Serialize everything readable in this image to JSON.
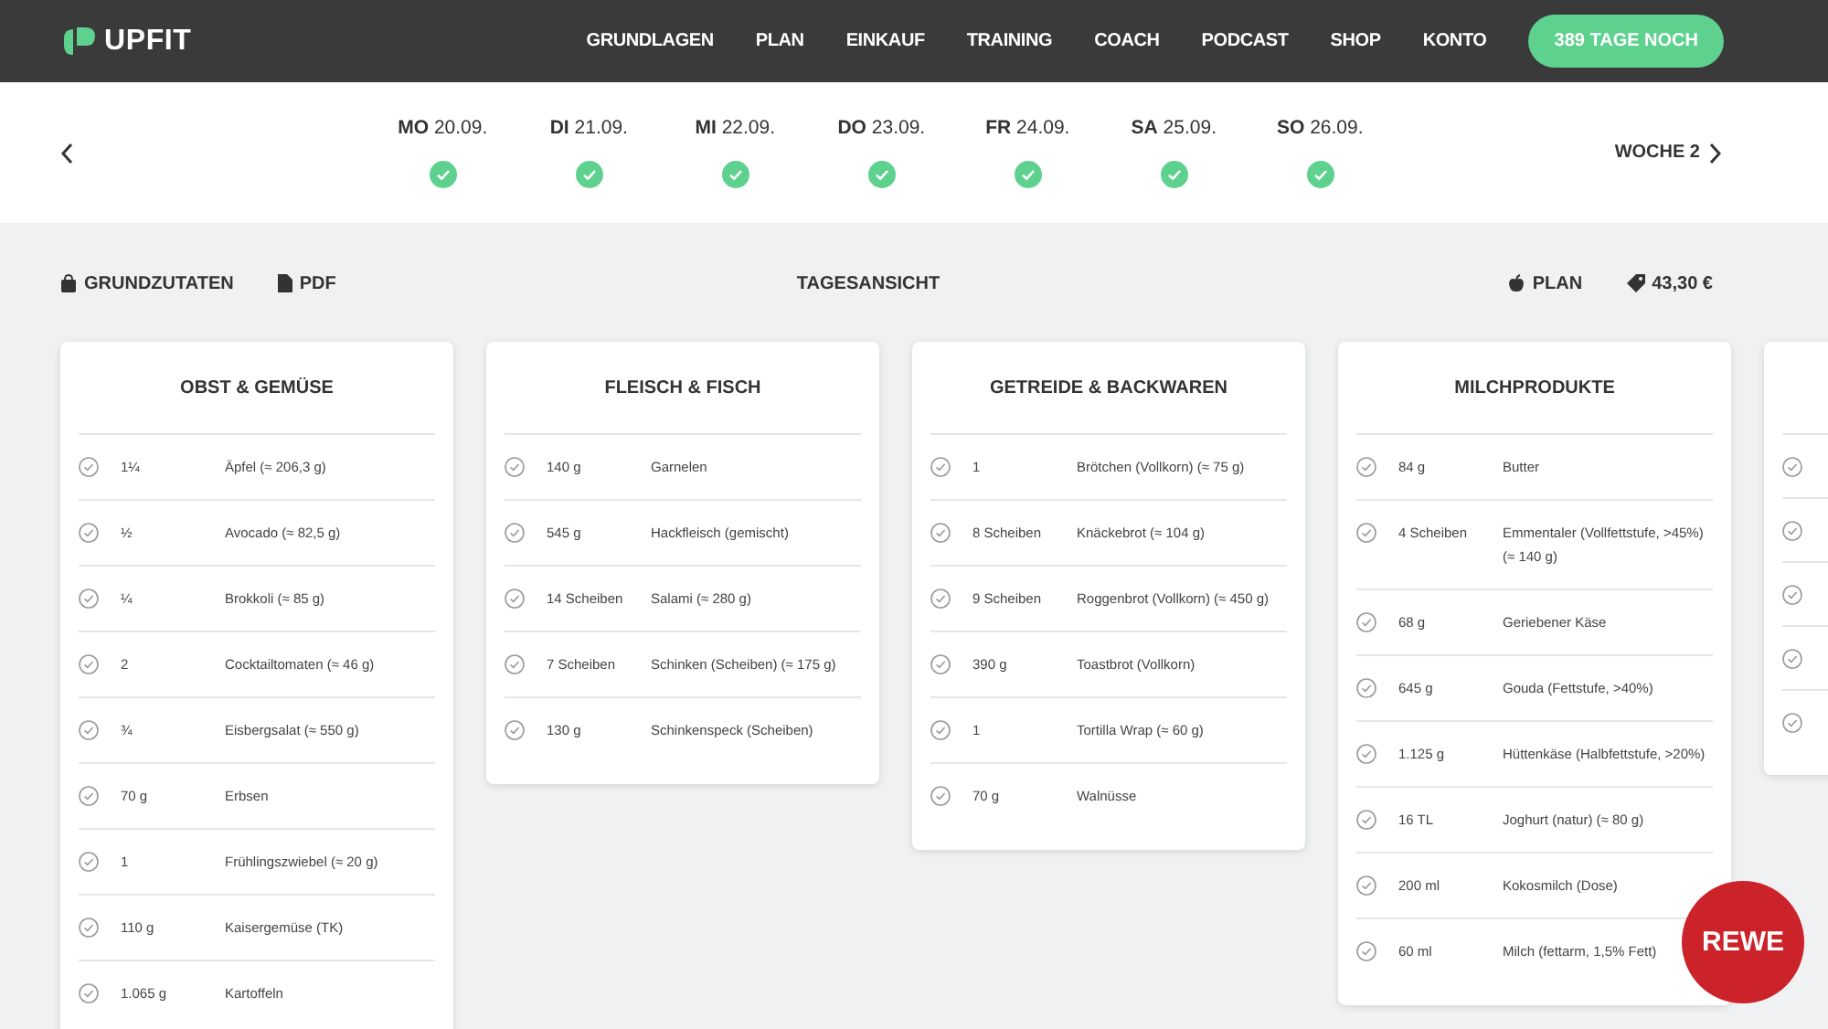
{
  "brand": "UPFIT",
  "nav": [
    {
      "label": "GRUNDLAGEN"
    },
    {
      "label": "PLAN"
    },
    {
      "label": "EINKAUF"
    },
    {
      "label": "TRAINING"
    },
    {
      "label": "COACH"
    },
    {
      "label": "PODCAST"
    },
    {
      "label": "SHOP"
    },
    {
      "label": "KONTO"
    }
  ],
  "cta": "389 TAGE NOCH",
  "days": [
    {
      "weekday": "MO",
      "date": "20.09.",
      "checked": true
    },
    {
      "weekday": "DI",
      "date": "21.09.",
      "checked": true
    },
    {
      "weekday": "MI",
      "date": "22.09.",
      "checked": true
    },
    {
      "weekday": "DO",
      "date": "23.09.",
      "checked": true
    },
    {
      "weekday": "FR",
      "date": "24.09.",
      "checked": true
    },
    {
      "weekday": "SA",
      "date": "25.09.",
      "checked": true
    },
    {
      "weekday": "SO",
      "date": "26.09.",
      "checked": true
    }
  ],
  "week": "WOCHE 2",
  "toolbar": {
    "ingredients": "GRUNDZUTATEN",
    "pdf": "PDF",
    "view": "TAGESANSICHT",
    "plan": "PLAN",
    "price": "43,30 €"
  },
  "categories": [
    {
      "title": "OBST & GEMÜSE",
      "items": [
        {
          "qty": "1¼",
          "name": "Äpfel (≈ 206,3 g)",
          "checked": false
        },
        {
          "qty": "½",
          "name": "Avocado (≈ 82,5 g)",
          "checked": false
        },
        {
          "qty": "¼",
          "name": "Brokkoli (≈ 85 g)",
          "checked": false
        },
        {
          "qty": "2",
          "name": "Cocktailtomaten (≈ 46 g)",
          "checked": false
        },
        {
          "qty": "¾",
          "name": "Eisbergsalat (≈ 550 g)",
          "checked": false
        },
        {
          "qty": "70 g",
          "name": "Erbsen",
          "checked": false
        },
        {
          "qty": "1",
          "name": "Frühlingszwiebel (≈ 20 g)",
          "checked": false
        },
        {
          "qty": "110 g",
          "name": "Kaisergemüse (TK)",
          "checked": false
        },
        {
          "qty": "1.065 g",
          "name": "Kartoffeln",
          "checked": false
        }
      ]
    },
    {
      "title": "FLEISCH & FISCH",
      "items": [
        {
          "qty": "140 g",
          "name": "Garnelen",
          "checked": false
        },
        {
          "qty": "545 g",
          "name": "Hackfleisch (gemischt)",
          "checked": false
        },
        {
          "qty": "14 Scheiben",
          "name": "Salami (≈ 280 g)",
          "checked": false
        },
        {
          "qty": "7 Scheiben",
          "name": "Schinken (Scheiben) (≈ 175 g)",
          "checked": false
        },
        {
          "qty": "130 g",
          "name": "Schinkenspeck (Scheiben)",
          "checked": false
        }
      ]
    },
    {
      "title": "GETREIDE & BACKWAREN",
      "items": [
        {
          "qty": "1",
          "name": "Brötchen (Vollkorn) (≈ 75 g)",
          "checked": false
        },
        {
          "qty": "8 Scheiben",
          "name": "Knäckebrot (≈ 104 g)",
          "checked": false
        },
        {
          "qty": "9 Scheiben",
          "name": "Roggenbrot (Vollkorn) (≈ 450 g)",
          "checked": false
        },
        {
          "qty": "390 g",
          "name": "Toastbrot (Vollkorn)",
          "checked": false
        },
        {
          "qty": "1",
          "name": "Tortilla Wrap (≈ 60 g)",
          "checked": false
        },
        {
          "qty": "70 g",
          "name": "Walnüsse",
          "checked": false
        }
      ]
    },
    {
      "title": "MILCHPRODUKTE",
      "items": [
        {
          "qty": "84 g",
          "name": "Butter",
          "checked": false
        },
        {
          "qty": "4 Scheiben",
          "name": "Emmentaler (Vollfettstufe, >45%) (≈ 140 g)",
          "checked": false
        },
        {
          "qty": "68 g",
          "name": "Geriebener Käse",
          "checked": false
        },
        {
          "qty": "645 g",
          "name": "Gouda (Fettstufe, >40%)",
          "checked": false
        },
        {
          "qty": "1.125 g",
          "name": "Hüttenkäse (Halbfettstufe, >20%)",
          "checked": false
        },
        {
          "qty": "16 TL",
          "name": "Joghurt (natur) (≈ 80 g)",
          "checked": false
        },
        {
          "qty": "200 ml",
          "name": "Kokosmilch (Dose)",
          "checked": false
        },
        {
          "qty": "60 ml",
          "name": "Milch (fettarm, 1,5% Fett)",
          "checked": false
        }
      ]
    },
    {
      "items": [
        {
          "checked": false
        },
        {
          "checked": false
        },
        {
          "checked": false
        },
        {
          "checked": false
        },
        {
          "checked": false
        }
      ]
    }
  ],
  "store_badge": "REWE"
}
